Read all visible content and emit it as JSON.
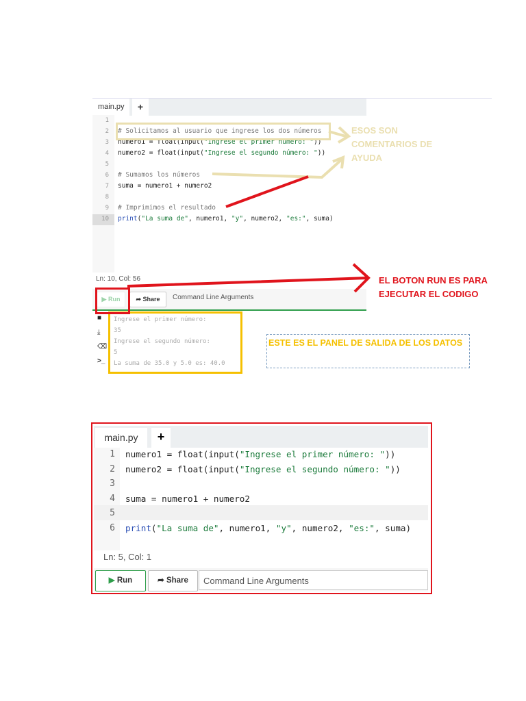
{
  "shot1": {
    "tab": "main.py",
    "add_tab": "+",
    "lines": [
      {
        "n": "1",
        "t": ""
      },
      {
        "n": "2",
        "t": "# Solicitamos al usuario que ingrese los dos números"
      },
      {
        "n": "3",
        "t": "numero1 = float(input(\"Ingrese el primer número: \"))"
      },
      {
        "n": "4",
        "t": "numero2 = float(input(\"Ingrese el segundo número: \"))"
      },
      {
        "n": "5",
        "t": ""
      },
      {
        "n": "6",
        "t": "# Sumamos los números"
      },
      {
        "n": "7",
        "t": "suma = numero1 + numero2"
      },
      {
        "n": "8",
        "t": ""
      },
      {
        "n": "9",
        "t": "# Imprimimos el resultado"
      },
      {
        "n": "10",
        "t": "print(\"La suma de\", numero1, \"y\", numero2, \"es:\", suma)"
      }
    ],
    "status": "Ln: 10, Col: 56",
    "run": "Run",
    "share": "Share",
    "args": "Command Line Arguments",
    "output": [
      "Ingrese el primer número:",
      "35",
      "Ingrese el segundo número:",
      "5",
      "La suma de 35.0 y 5.0 es: 40.0"
    ]
  },
  "annotations": {
    "help": "ESOS SON COMENTARIOS DE AYUDA",
    "run": "EL BOTON RUN ES PARA EJECUTAR EL CODIGO",
    "output": "ESTE ES EL PANEL DE SALIDA DE LOS DATOS",
    "colors": {
      "red": "#e0141c",
      "yellow": "#f5c000",
      "beige": "#eadfb0"
    }
  },
  "shot2": {
    "tab": "main.py",
    "add_tab": "+",
    "lines": [
      {
        "n": "1",
        "t": "numero1 = float(input(\"Ingrese el primer número: \"))"
      },
      {
        "n": "2",
        "t": "numero2 = float(input(\"Ingrese el segundo número: \"))"
      },
      {
        "n": "3",
        "t": ""
      },
      {
        "n": "4",
        "t": "suma = numero1 + numero2"
      },
      {
        "n": "5",
        "t": ""
      },
      {
        "n": "6",
        "t": "print(\"La suma de\", numero1, \"y\", numero2, \"es:\", suma)"
      }
    ],
    "status": "Ln: 5,  Col: 1",
    "run": "Run",
    "share": "Share",
    "args": "Command Line Arguments"
  }
}
